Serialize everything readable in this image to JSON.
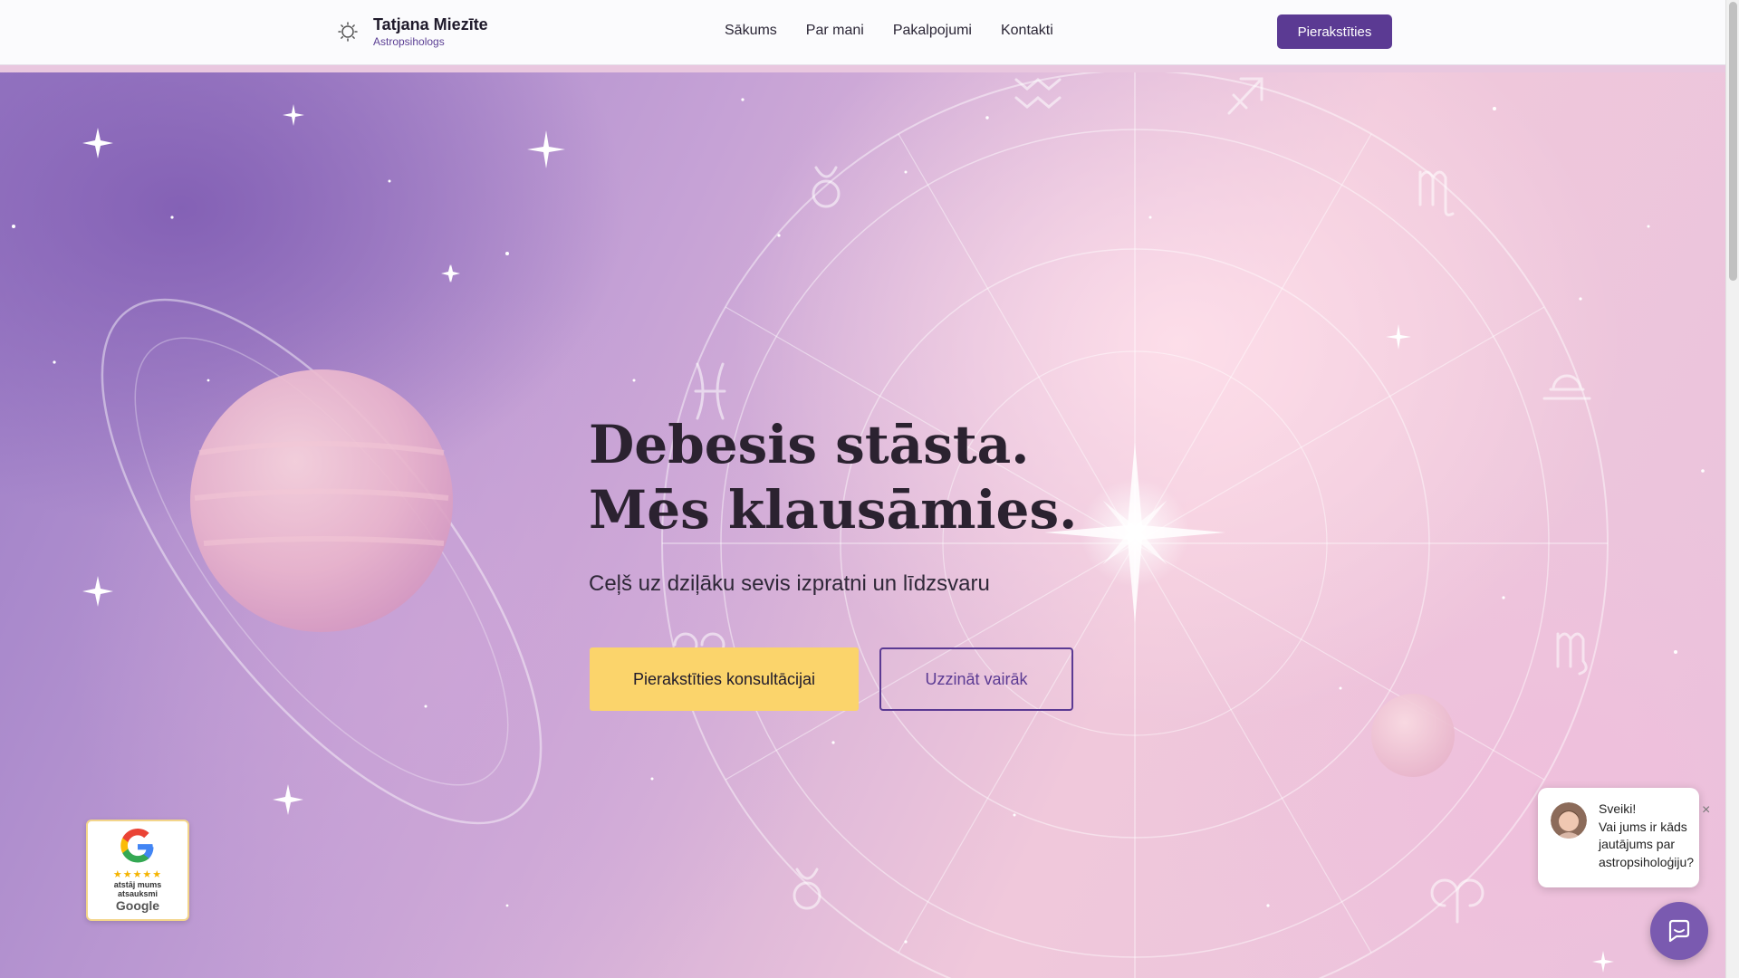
{
  "header": {
    "brand_name": "Tatjana Miezīte",
    "brand_subtitle": "Astropsihologs",
    "logo_icon": "sun-icon",
    "nav": [
      {
        "label": "Sākums"
      },
      {
        "label": "Par mani"
      },
      {
        "label": "Pakalpojumi"
      },
      {
        "label": "Kontakti"
      }
    ],
    "cta_label": "Pierakstīties"
  },
  "hero": {
    "headline_line1": "Debesis stāsta.",
    "headline_line2": "Mēs klausāmies.",
    "subheadline": "Ceļš uz dziļāku sevis izpratni un līdzsvaru",
    "primary_button": "Pierakstīties konsultācijai",
    "secondary_button": "Uzzināt vairāk"
  },
  "google_badge": {
    "stars": "★★★★★",
    "text_line1": "atstāj mums",
    "text_line2": "atsauksmi",
    "brand": "Google"
  },
  "chat": {
    "greeting": "Sveiki!",
    "message": "Vai jums ir kāds jautājums par astropsiholoģiju?",
    "close_icon": "close-icon",
    "launcher_icon": "chat-icon"
  },
  "colors": {
    "accent": "#5b3a93",
    "button_yellow": "#fbd46b",
    "text_dark": "#2b2230"
  }
}
